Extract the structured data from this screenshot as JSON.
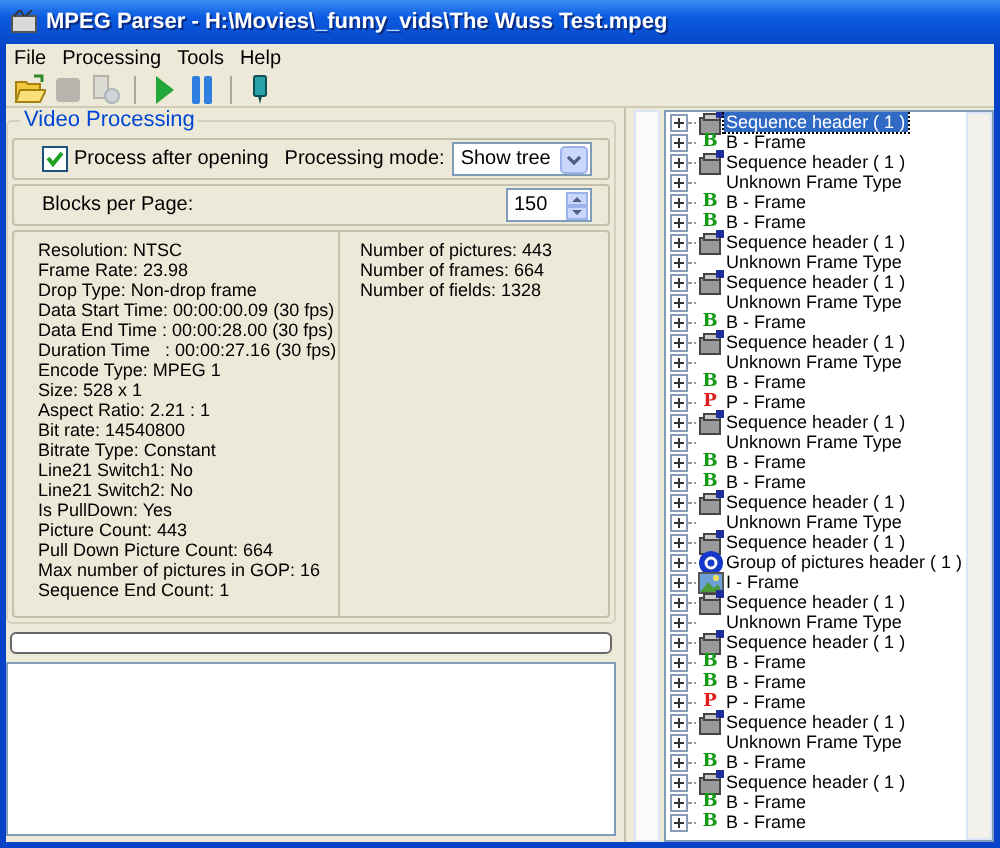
{
  "window": {
    "title": "MPEG Parser - H:\\Movies\\_funny_vids\\The Wuss Test.mpeg"
  },
  "menu": [
    {
      "label": "File"
    },
    {
      "label": "Processing"
    },
    {
      "label": "Tools"
    },
    {
      "label": "Help"
    }
  ],
  "toolbar": [
    {
      "kind": "open",
      "disabled": false
    },
    {
      "kind": "stop",
      "disabled": true
    },
    {
      "kind": "document",
      "disabled": true
    },
    {
      "kind": "separator"
    },
    {
      "kind": "play",
      "disabled": false
    },
    {
      "kind": "pause",
      "disabled": false
    },
    {
      "kind": "separator"
    },
    {
      "kind": "marker",
      "disabled": false
    }
  ],
  "video_processing": {
    "title": "Video Processing",
    "process_after_opening": {
      "label": "Process after opening",
      "checked": true
    },
    "processing_mode": {
      "label": "Processing mode:",
      "value": "Show tree"
    },
    "blocks_per_page": {
      "label": "Blocks per Page:",
      "value": "150"
    },
    "info_left": [
      "Resolution: NTSC",
      "Frame Rate: 23.98",
      "Drop Type: Non-drop frame",
      "Data Start Time: 00:00:00.09 (30 fps)",
      "Data End Time : 00:00:28.00 (30 fps)",
      "Duration Time   : 00:00:27.16 (30 fps)",
      "Encode Type: MPEG 1",
      "Size: 528 x 1",
      "Aspect Ratio: 2.21 : 1",
      "Bit rate: 14540800",
      "Bitrate Type: Constant",
      "Line21 Switch1: No",
      "Line21 Switch2: No",
      "Is PullDown: Yes",
      "Picture Count: 443",
      "Pull Down Picture Count: 664",
      "Max number of pictures in GOP: 16",
      "Sequence End Count: 1"
    ],
    "info_right": [
      "Number of pictures: 443",
      "Number of frames: 664",
      "Number of fields: 1328"
    ],
    "progress": {
      "level": 0
    }
  },
  "tree": [
    {
      "label": "Sequence header ( 1 )",
      "kind": "seq",
      "selected": true
    },
    {
      "label": "B - Frame",
      "kind": "b",
      "badge": "B",
      "selected": false
    },
    {
      "label": "Sequence header ( 1 )",
      "kind": "seq",
      "selected": false
    },
    {
      "label": "Unknown Frame Type",
      "kind": "unknown",
      "selected": false
    },
    {
      "label": "B - Frame",
      "kind": "b",
      "badge": "B",
      "selected": false
    },
    {
      "label": "B - Frame",
      "kind": "b",
      "badge": "B",
      "selected": false
    },
    {
      "label": "Sequence header ( 1 )",
      "kind": "seq",
      "selected": false
    },
    {
      "label": "Unknown Frame Type",
      "kind": "unknown",
      "selected": false
    },
    {
      "label": "Sequence header ( 1 )",
      "kind": "seq",
      "selected": false
    },
    {
      "label": "Unknown Frame Type",
      "kind": "unknown",
      "selected": false
    },
    {
      "label": "B - Frame",
      "kind": "b",
      "badge": "B",
      "selected": false
    },
    {
      "label": "Sequence header ( 1 )",
      "kind": "seq",
      "selected": false
    },
    {
      "label": "Unknown Frame Type",
      "kind": "unknown",
      "selected": false
    },
    {
      "label": "B - Frame",
      "kind": "b",
      "badge": "B",
      "selected": false
    },
    {
      "label": "P - Frame",
      "kind": "p",
      "badge": "P",
      "selected": false
    },
    {
      "label": "Sequence header ( 1 )",
      "kind": "seq",
      "selected": false
    },
    {
      "label": "Unknown Frame Type",
      "kind": "unknown",
      "selected": false
    },
    {
      "label": "B - Frame",
      "kind": "b",
      "badge": "B",
      "selected": false
    },
    {
      "label": "B - Frame",
      "kind": "b",
      "badge": "B",
      "selected": false
    },
    {
      "label": "Sequence header ( 1 )",
      "kind": "seq",
      "selected": false
    },
    {
      "label": "Unknown Frame Type",
      "kind": "unknown",
      "selected": false
    },
    {
      "label": "Sequence header ( 1 )",
      "kind": "seq",
      "selected": false
    },
    {
      "label": "Group of pictures header ( 1 )",
      "kind": "gop",
      "selected": false
    },
    {
      "label": "I - Frame",
      "kind": "i",
      "selected": false
    },
    {
      "label": "Sequence header ( 1 )",
      "kind": "seq",
      "selected": false
    },
    {
      "label": "Unknown Frame Type",
      "kind": "unknown",
      "selected": false
    },
    {
      "label": "Sequence header ( 1 )",
      "kind": "seq",
      "selected": false
    },
    {
      "label": "B - Frame",
      "kind": "b",
      "badge": "B",
      "selected": false
    },
    {
      "label": "B - Frame",
      "kind": "b",
      "badge": "B",
      "selected": false
    },
    {
      "label": "P - Frame",
      "kind": "p",
      "badge": "P",
      "selected": false
    },
    {
      "label": "Sequence header ( 1 )",
      "kind": "seq",
      "selected": false
    },
    {
      "label": "Unknown Frame Type",
      "kind": "unknown",
      "selected": false
    },
    {
      "label": "B - Frame",
      "kind": "b",
      "badge": "B",
      "selected": false
    },
    {
      "label": "Sequence header ( 1 )",
      "kind": "seq",
      "selected": false
    },
    {
      "label": "B - Frame",
      "kind": "b",
      "badge": "B",
      "selected": false
    },
    {
      "label": "B - Frame",
      "kind": "b",
      "badge": "B",
      "selected": false
    }
  ]
}
